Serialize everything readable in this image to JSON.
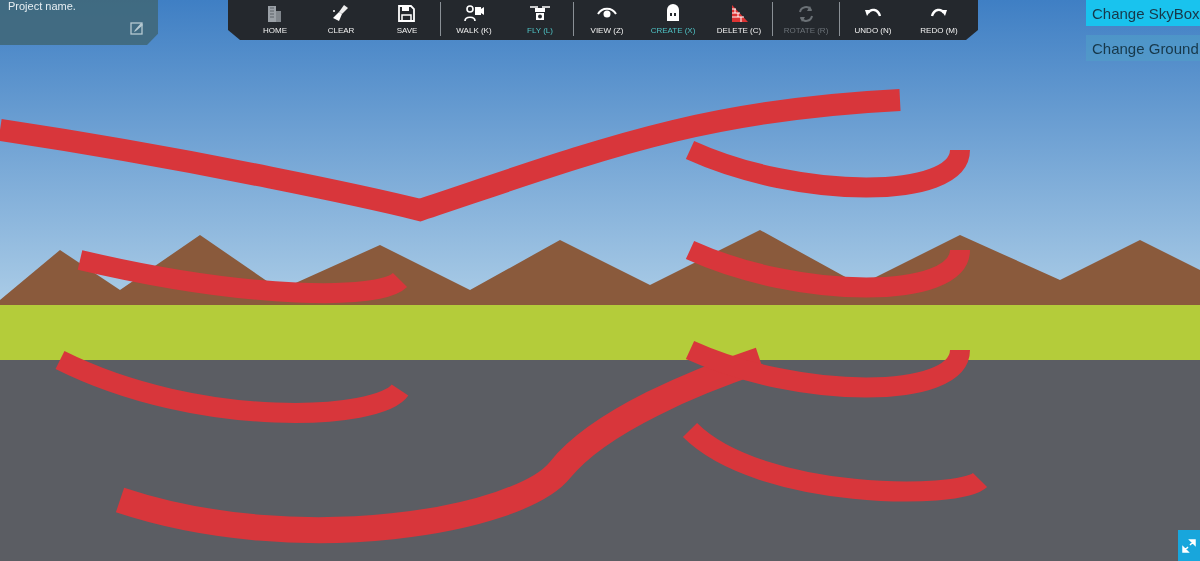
{
  "project_panel": {
    "label": "Project name."
  },
  "toolbar": {
    "groups": [
      [
        {
          "kind": "building",
          "label": "HOME",
          "selected": false,
          "disabled": false
        },
        {
          "kind": "brush",
          "label": "CLEAR",
          "selected": false,
          "disabled": false
        },
        {
          "kind": "floppy",
          "label": "SAVE",
          "selected": false,
          "disabled": false
        }
      ],
      [
        {
          "kind": "walk",
          "label": "WALK (K)",
          "selected": false,
          "disabled": false
        },
        {
          "kind": "drone",
          "label": "FLY (L)",
          "selected": true,
          "disabled": false
        }
      ],
      [
        {
          "kind": "eye",
          "label": "VIEW (Z)",
          "selected": false,
          "disabled": false
        },
        {
          "kind": "house",
          "label": "CREATE (X)",
          "selected": true,
          "disabled": false
        },
        {
          "kind": "bricks",
          "label": "DELETE (C)",
          "selected": false,
          "disabled": false
        }
      ],
      [
        {
          "kind": "rotate",
          "label": "ROTATE (R)",
          "selected": false,
          "disabled": true
        }
      ],
      [
        {
          "kind": "undo",
          "label": "UNDO (N)",
          "selected": false,
          "disabled": false
        },
        {
          "kind": "redo",
          "label": "REDO (M)",
          "selected": false,
          "disabled": false
        }
      ]
    ]
  },
  "side_buttons": [
    {
      "label": "Change SkyBox",
      "selected": true
    },
    {
      "label": "Change Ground",
      "selected": false
    }
  ]
}
